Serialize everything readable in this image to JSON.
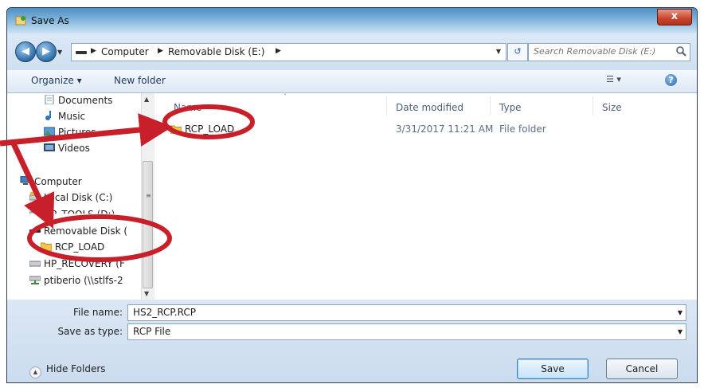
{
  "window": {
    "title": "Save As",
    "close_glyph": "x"
  },
  "address": {
    "crumbs": [
      "Computer",
      "Removable Disk (E:)"
    ],
    "search_placeholder": "Search Removable Disk (E:)"
  },
  "toolbar": {
    "organize": "Organize",
    "new_folder": "New folder"
  },
  "nav": {
    "items": [
      {
        "label": "Documents",
        "icon": "documents-icon"
      },
      {
        "label": "Music",
        "icon": "music-icon"
      },
      {
        "label": "Pictures",
        "icon": "pictures-icon"
      },
      {
        "label": "Videos",
        "icon": "videos-icon"
      },
      {
        "label": "Computer",
        "icon": "computer-icon"
      },
      {
        "label": "Local Disk (C:)",
        "icon": "local-disk-icon"
      },
      {
        "label": "HP_TOOLS (D:)",
        "icon": "drive-icon"
      },
      {
        "label": "Removable Disk (",
        "icon": "removable-disk-icon"
      },
      {
        "label": "RCP_LOAD",
        "icon": "folder-icon"
      },
      {
        "label": "HP_RECOVERY (F",
        "icon": "drive-icon"
      },
      {
        "label": "ptiberio (\\\\stlfs-2",
        "icon": "network-drive-icon"
      }
    ]
  },
  "files": {
    "columns": {
      "name": "Name",
      "date": "Date modified",
      "type": "Type",
      "size": "Size"
    },
    "rows": [
      {
        "name": "RCP_LOAD",
        "date": "3/31/2017 11:21 AM",
        "type": "File folder",
        "size": ""
      }
    ]
  },
  "form": {
    "file_name_label": "File name:",
    "file_name_value": "HS2_RCP.RCP",
    "save_type_label": "Save as type:",
    "save_type_value": "RCP File"
  },
  "footer": {
    "hide_folders": "Hide Folders",
    "save": "Save",
    "cancel": "Cancel"
  },
  "colors": {
    "annotation": "#c8202a",
    "titlebar": "#4d8fc3"
  }
}
